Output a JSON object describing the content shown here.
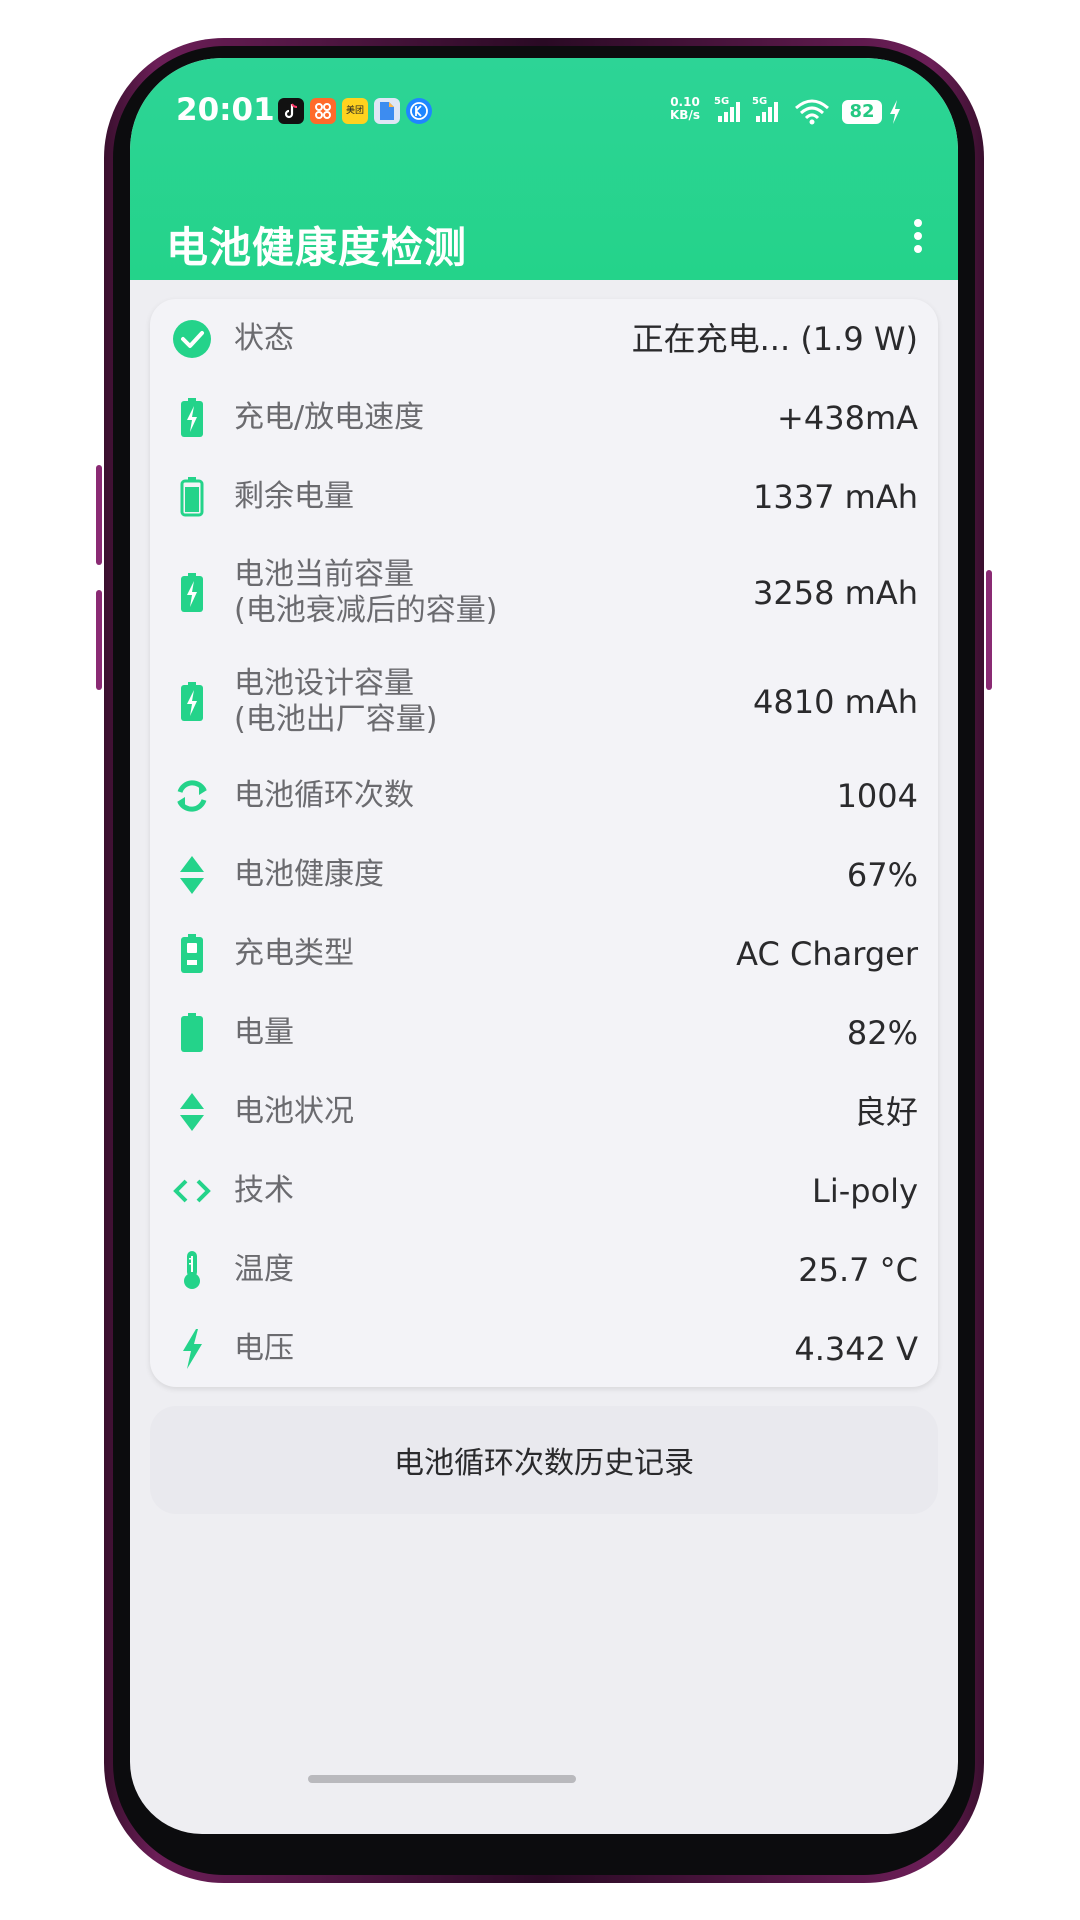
{
  "status_bar": {
    "time": "20:01",
    "net_speed_value": "0.10",
    "net_speed_unit": "KB/s",
    "signal1_label": "5G",
    "signal2_label": "5G",
    "battery_level": "82",
    "notification_badges": [
      "美团"
    ],
    "notification_icons": [
      "tiktok-icon",
      "app-icon",
      "meituan-icon",
      "files-icon",
      "kugou-icon"
    ]
  },
  "app_bar": {
    "title": "电池健康度检测"
  },
  "accent_color": "#24d38a",
  "battery_info": {
    "rows": [
      {
        "icon": "check-circle-icon",
        "label": "状态",
        "value": "正在充电... (1.9 W)"
      },
      {
        "icon": "battery-charging-icon",
        "label": "充电/放电速度",
        "value": "+438mA"
      },
      {
        "icon": "battery-full-icon",
        "label": "剩余电量",
        "value": "1337 mAh"
      },
      {
        "icon": "battery-charging-icon",
        "label": "电池当前容量",
        "label2": "(电池衰减后的容量)",
        "value": "3258 mAh"
      },
      {
        "icon": "battery-charging-icon",
        "label": "电池设计容量",
        "label2": "(电池出厂容量)",
        "value": "4810 mAh"
      },
      {
        "icon": "cycle-icon",
        "label": "电池循环次数",
        "value": "1004"
      },
      {
        "icon": "up-down-arrows-icon",
        "label": "电池健康度",
        "value": "67%"
      },
      {
        "icon": "battery-plug-icon",
        "label": "充电类型",
        "value": "AC Charger"
      },
      {
        "icon": "battery-solid-icon",
        "label": "电量",
        "value": "82%"
      },
      {
        "icon": "up-down-arrows-icon",
        "label": "电池状况",
        "value": "良好"
      },
      {
        "icon": "code-brackets-icon",
        "label": "技术",
        "value": "Li-poly"
      },
      {
        "icon": "thermometer-icon",
        "label": "温度",
        "value": "25.7 °C"
      },
      {
        "icon": "lightning-icon",
        "label": "电压",
        "value": "4.342 V"
      }
    ]
  },
  "history_button": {
    "label": "电池循环次数历史记录"
  }
}
